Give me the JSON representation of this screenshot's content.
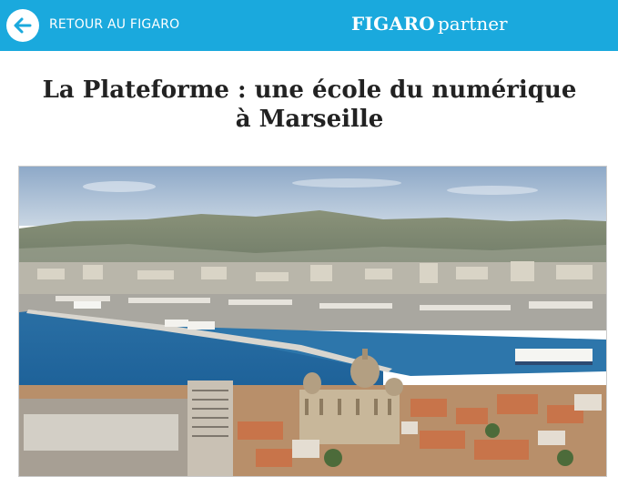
{
  "header": {
    "back_label": "RETOUR AU FIGARO",
    "logo_part1": "FIGARO",
    "logo_part2": "partner",
    "accent_color": "#1aa9dd",
    "back_icon": "arrow-left-circle-icon"
  },
  "article": {
    "title": "La Plateforme : une école du numérique à Marseille"
  }
}
